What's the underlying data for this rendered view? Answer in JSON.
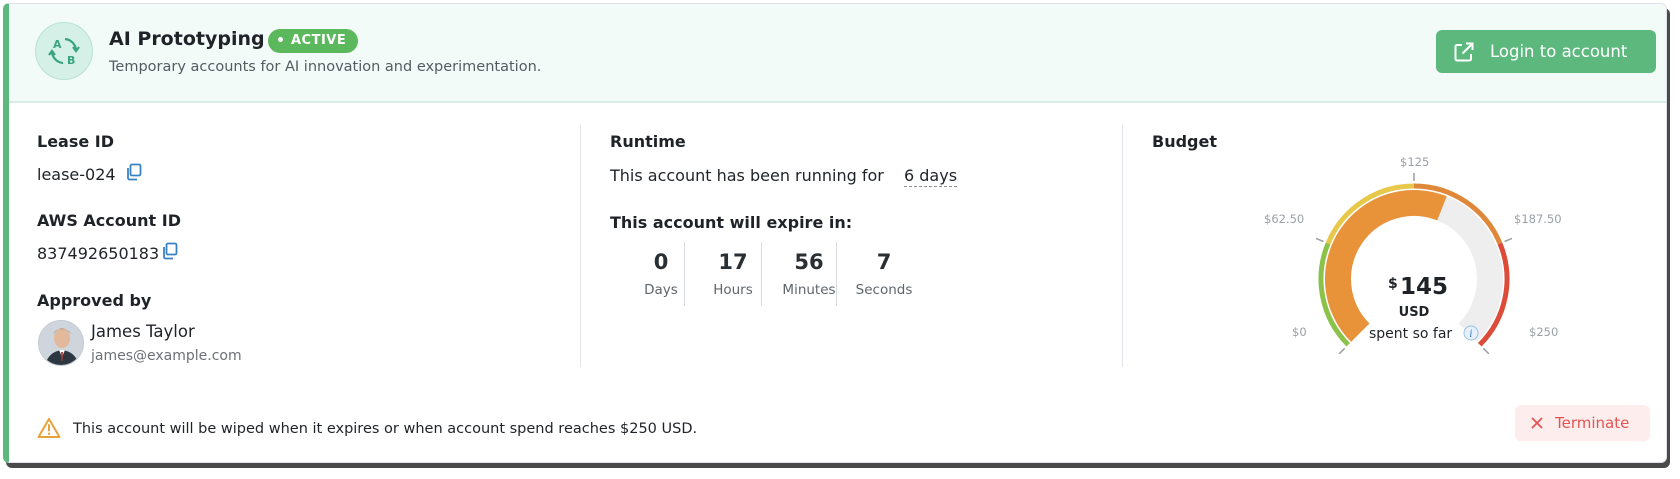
{
  "header": {
    "title": "AI Prototyping",
    "status_badge": "ACTIVE",
    "subtitle": "Temporary accounts for AI innovation and experimentation.",
    "login_button": "Login to account"
  },
  "lease": {
    "lease_id_label": "Lease ID",
    "lease_id": "lease-024",
    "aws_account_label": "AWS Account ID",
    "aws_account_id": "837492650183",
    "approved_by_label": "Approved by",
    "approver_name": "James Taylor",
    "approver_email": "james@example.com"
  },
  "runtime": {
    "label": "Runtime",
    "running_text": "This account has been running for",
    "running_value": "6 days",
    "expire_label": "This account will expire in:",
    "countdown": [
      {
        "value": "0",
        "unit": "Days"
      },
      {
        "value": "17",
        "unit": "Hours"
      },
      {
        "value": "56",
        "unit": "Minutes"
      },
      {
        "value": "7",
        "unit": "Seconds"
      }
    ]
  },
  "budget": {
    "label": "Budget",
    "currency_symbol": "$",
    "spent": "145",
    "spent_value": 145,
    "max_value": 250,
    "currency": "USD",
    "spent_caption": "spent so far",
    "tick_labels": [
      "$0",
      "$62.50",
      "$125",
      "$187.50",
      "$250"
    ],
    "colors": {
      "spent_arc": "#e8923a",
      "track": "#eeeeee",
      "green": "#8bc34a",
      "yellow": "#e8c84a",
      "orange": "#e0883a",
      "red": "#dd4b39"
    }
  },
  "footer": {
    "warning_text": "This account will be wiped when it expires or when account spend reaches $250 USD.",
    "terminate_button": "Terminate"
  },
  "icons": {
    "logo": "ab-swap-icon",
    "login": "external-link-icon",
    "copy": "copy-icon",
    "info": "info-icon",
    "warning": "warning-triangle-icon",
    "close": "close-icon"
  }
}
